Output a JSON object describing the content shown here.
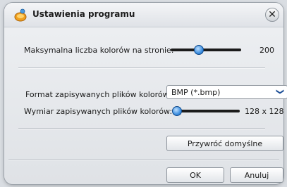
{
  "dialog": {
    "title": "Ustawienia programu",
    "close_glyph": "✕"
  },
  "settings": {
    "max_colors": {
      "label": "Maksymalna liczba kolorów na stronie:",
      "value": "200",
      "level": 0.38
    },
    "format": {
      "label": "Format zapisywanych plików kolorów:",
      "selected": "BMP (*.bmp)",
      "chevron": "❯"
    },
    "dimension": {
      "label": "Wymiar zapisywanych plików kolorów:",
      "value": "128 x 128",
      "level": 0.0
    }
  },
  "buttons": {
    "restore": "Przywróć domyślne",
    "ok": "OK",
    "cancel": "Anuluj"
  },
  "colors": {
    "accent": "#3e8fe0",
    "chevron": "#1d4f97"
  }
}
